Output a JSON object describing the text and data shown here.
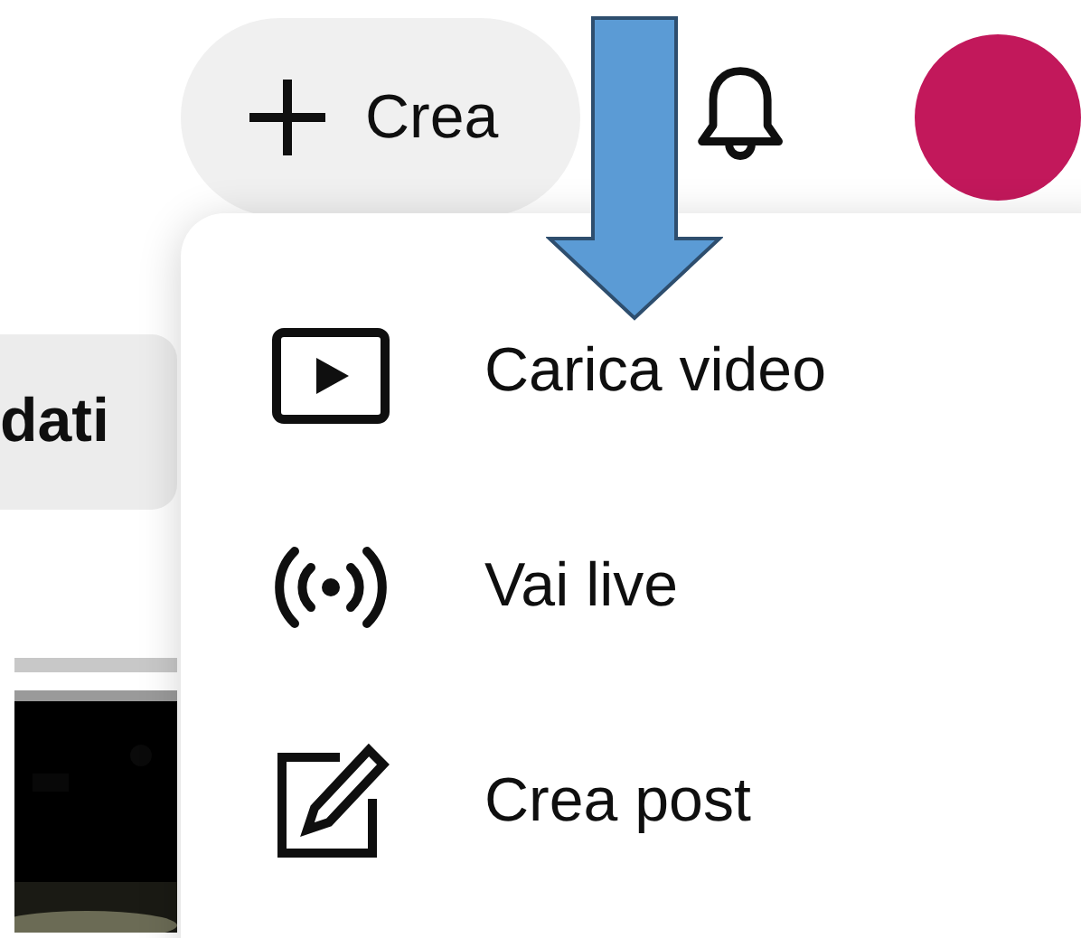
{
  "header": {
    "create_button": {
      "label": "Crea"
    }
  },
  "chip": {
    "label": "dati"
  },
  "create_menu": {
    "items": [
      {
        "kind": "upload",
        "label": "Carica video"
      },
      {
        "kind": "live",
        "label": "Vai live"
      },
      {
        "kind": "post",
        "label": "Crea post"
      }
    ]
  }
}
